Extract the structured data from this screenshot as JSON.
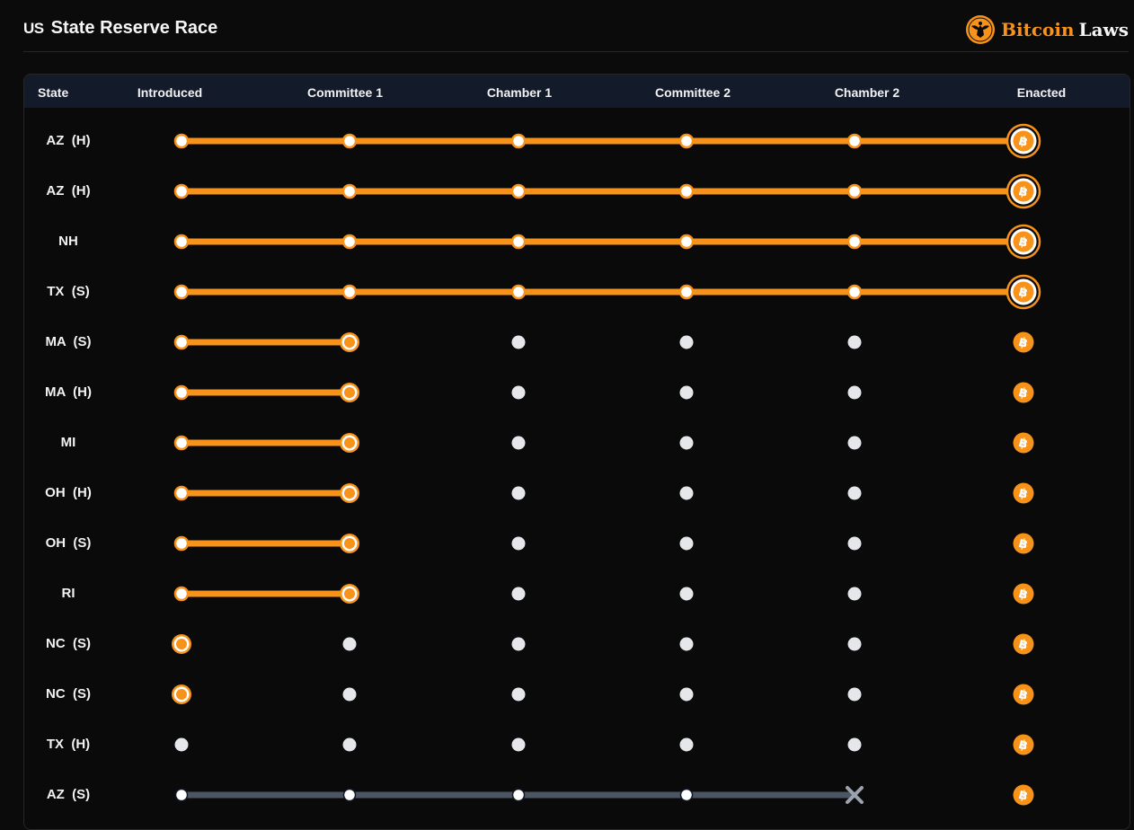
{
  "header": {
    "flag": "US",
    "title": "State Reserve Race",
    "brand_a": "Bitcoin",
    "brand_b": "Laws"
  },
  "colors": {
    "accent": "#f7931a",
    "inactive": "#e5e7eb",
    "failed": "#4b5563",
    "header_bg": "#131a2a"
  },
  "columns": [
    "State",
    "Introduced",
    "Committee 1",
    "Chamber 1",
    "Committee 2",
    "Chamber 2",
    "Enacted"
  ],
  "icons": {
    "brand": "eagle-seal-icon",
    "enacted": "bitcoin-icon",
    "failed": "x-icon"
  },
  "rows": [
    {
      "state": "AZ  (H)",
      "stage": 5,
      "status": "enacted"
    },
    {
      "state": "AZ  (H)",
      "stage": 5,
      "status": "enacted"
    },
    {
      "state": "NH",
      "stage": 5,
      "status": "enacted"
    },
    {
      "state": "TX  (S)",
      "stage": 5,
      "status": "enacted"
    },
    {
      "state": "MA  (S)",
      "stage": 1,
      "status": "active"
    },
    {
      "state": "MA  (H)",
      "stage": 1,
      "status": "active"
    },
    {
      "state": "MI",
      "stage": 1,
      "status": "active"
    },
    {
      "state": "OH  (H)",
      "stage": 1,
      "status": "active"
    },
    {
      "state": "OH  (S)",
      "stage": 1,
      "status": "active"
    },
    {
      "state": "RI",
      "stage": 1,
      "status": "active"
    },
    {
      "state": "NC  (S)",
      "stage": 0,
      "status": "active"
    },
    {
      "state": "NC  (S)",
      "stage": 0,
      "status": "active"
    },
    {
      "state": "TX  (H)",
      "stage": -1,
      "status": "pending"
    },
    {
      "state": "AZ  (S)",
      "stage": 4,
      "status": "failed"
    }
  ]
}
